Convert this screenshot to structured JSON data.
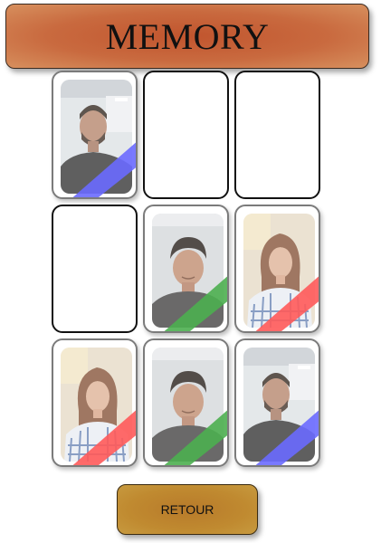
{
  "header": {
    "title": "MEMORY"
  },
  "board": {
    "cards": [
      {
        "row": 0,
        "col": 0,
        "state": "face-up",
        "face": "man-beard-office",
        "pair_color": "#6a6aff"
      },
      {
        "row": 0,
        "col": 1,
        "state": "face-down"
      },
      {
        "row": 0,
        "col": 2,
        "state": "face-down"
      },
      {
        "row": 1,
        "col": 0,
        "state": "face-down"
      },
      {
        "row": 1,
        "col": 1,
        "state": "face-up",
        "face": "man-curly-hair",
        "pair_color": "#4caf50"
      },
      {
        "row": 1,
        "col": 2,
        "state": "face-up",
        "face": "woman-long-hair",
        "pair_color": "#ff5a5a"
      },
      {
        "row": 2,
        "col": 0,
        "state": "face-up",
        "face": "woman-long-hair",
        "pair_color": "#ff5a5a"
      },
      {
        "row": 2,
        "col": 1,
        "state": "face-up",
        "face": "man-curly-hair",
        "pair_color": "#4caf50"
      },
      {
        "row": 2,
        "col": 2,
        "state": "face-up",
        "face": "man-beard-office",
        "pair_color": "#6a6aff"
      }
    ]
  },
  "footer": {
    "back_label": "RETOUR"
  },
  "colors": {
    "title_banner": "#c96a3f",
    "back_button": "#c08a30",
    "card_border": "#111111"
  }
}
